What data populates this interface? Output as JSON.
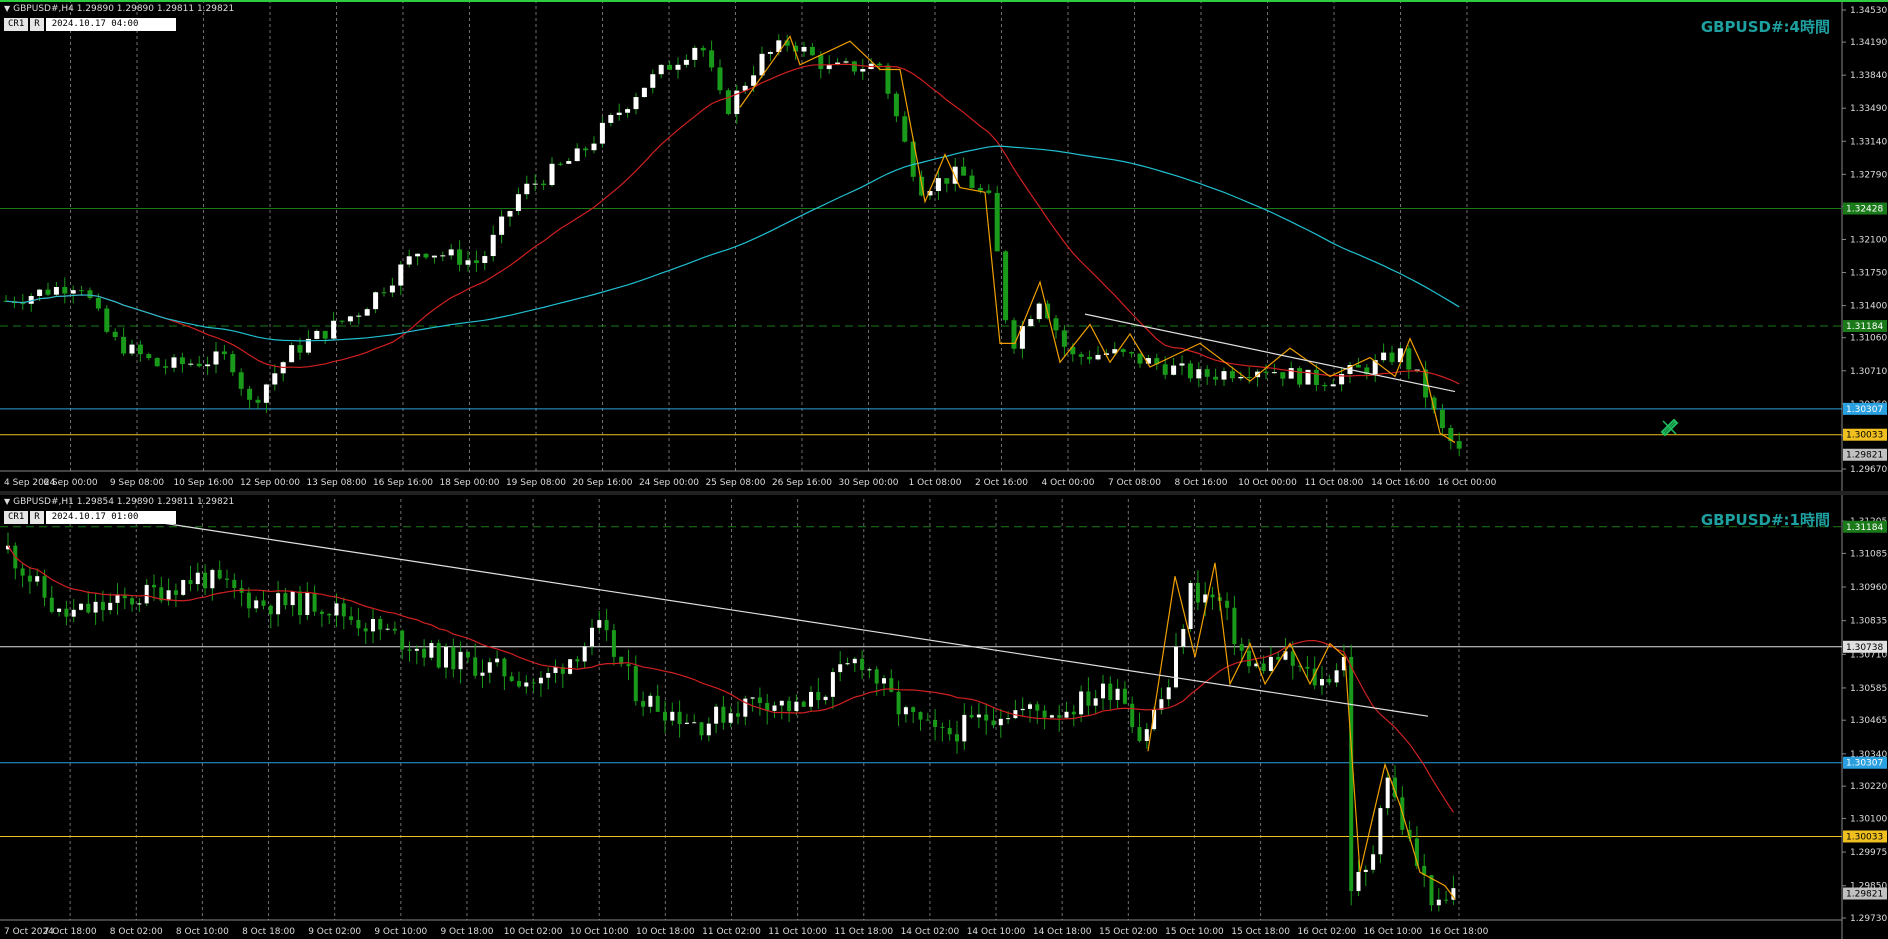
{
  "top": {
    "header": "GBPUSD#,H4  1.29890 1.29890 1.29811 1.29821",
    "chips": [
      "CR1",
      "R"
    ],
    "date": "2024.10.17 04:00",
    "timeframe_label": "GBPUSD#:4時間",
    "ymin": 1.2967,
    "ymax": 1.3453,
    "price_ticks": [
      "1.34530",
      "1.34190",
      "1.33840",
      "1.33490",
      "1.33140",
      "1.32790",
      "1.32450",
      "1.32100",
      "1.31750",
      "1.31400",
      "1.31060",
      "1.30710",
      "1.30360",
      "1.30021",
      "1.29670"
    ],
    "price_tick_values": [
      1.3453,
      1.3419,
      1.3384,
      1.3349,
      1.3314,
      1.3279,
      1.3245,
      1.321,
      1.3175,
      1.314,
      1.3106,
      1.3071,
      1.3036,
      1.30021,
      1.2967
    ],
    "time_labels": [
      "4 Sep 2024",
      "6 Sep 00:00",
      "9 Sep 08:00",
      "10 Sep 16:00",
      "12 Sep 00:00",
      "13 Sep 08:00",
      "16 Sep 16:00",
      "18 Sep 00:00",
      "19 Sep 08:00",
      "20 Sep 16:00",
      "24 Sep 00:00",
      "25 Sep 08:00",
      "26 Sep 16:00",
      "30 Sep 00:00",
      "1 Oct 08:00",
      "2 Oct 16:00",
      "4 Oct 00:00",
      "7 Oct 08:00",
      "8 Oct 16:00",
      "10 Oct 00:00",
      "11 Oct 08:00",
      "14 Oct 16:00",
      "16 Oct 00:00"
    ],
    "levels": [
      {
        "value": 1.32428,
        "label": "1.32428",
        "color": "#1a7a1a",
        "style": "solid"
      },
      {
        "value": 1.31184,
        "label": "1.31184",
        "color": "#1a7a1a",
        "style": "dashed"
      },
      {
        "value": 1.30307,
        "label": "1.30307",
        "color": "#2aa0e0",
        "style": "solid"
      },
      {
        "value": 1.30033,
        "label": "1.30033",
        "color": "#f0c020",
        "style": "solid"
      },
      {
        "value": 1.29821,
        "label": "1.29821",
        "color": "#c0c0c0",
        "style": "solid"
      }
    ]
  },
  "bottom": {
    "header": "GBPUSD#,H1  1.29854 1.29890 1.29811 1.29821",
    "chips": [
      "CR1",
      "R"
    ],
    "date": "2024.10.17 01:00",
    "timeframe_label": "GBPUSD#:1時間",
    "ymin": 1.2973,
    "ymax": 1.3125,
    "price_ticks": [
      "1.31205",
      "1.31085",
      "1.30960",
      "1.30835",
      "1.30710",
      "1.30585",
      "1.30465",
      "1.30340",
      "1.30220",
      "1.30100",
      "1.29975",
      "1.29850",
      "1.29730"
    ],
    "price_tick_values": [
      1.31205,
      1.31085,
      1.3096,
      1.30835,
      1.3071,
      1.30585,
      1.30465,
      1.3034,
      1.3022,
      1.301,
      1.29975,
      1.2985,
      1.2973
    ],
    "time_labels": [
      "7 Oct 2024",
      "7 Oct 18:00",
      "8 Oct 02:00",
      "8 Oct 10:00",
      "8 Oct 18:00",
      "9 Oct 02:00",
      "9 Oct 10:00",
      "9 Oct 18:00",
      "10 Oct 02:00",
      "10 Oct 10:00",
      "10 Oct 18:00",
      "11 Oct 02:00",
      "11 Oct 10:00",
      "11 Oct 18:00",
      "14 Oct 02:00",
      "14 Oct 10:00",
      "14 Oct 18:00",
      "15 Oct 02:00",
      "15 Oct 10:00",
      "15 Oct 18:00",
      "16 Oct 02:00",
      "16 Oct 10:00",
      "16 Oct 18:00"
    ],
    "levels": [
      {
        "value": 1.31184,
        "label": "1.31184",
        "color": "#1a7a1a",
        "style": "dashed"
      },
      {
        "value": 1.30738,
        "label": "1.30738",
        "color": "#e0e0e0",
        "style": "solid"
      },
      {
        "value": 1.30307,
        "label": "1.30307",
        "color": "#2aa0e0",
        "style": "solid"
      },
      {
        "value": 1.30033,
        "label": "1.30033",
        "color": "#f0c020",
        "style": "solid"
      },
      {
        "value": 1.29821,
        "label": "1.29821",
        "color": "#c0c0c0",
        "style": "solid"
      }
    ]
  },
  "colors": {
    "bull": "#ffffff",
    "bear": "#1a9a1a",
    "ma_red": "#d02020",
    "ma_cyan": "#20c0d0",
    "zigzag": "#f0a000",
    "trend": "#e0e0e0"
  },
  "icons": {
    "pencil": "pencil-eraser-icon"
  }
}
